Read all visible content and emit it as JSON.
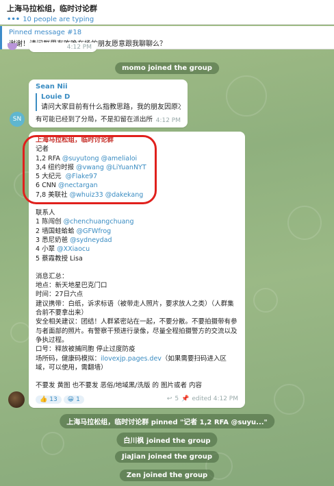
{
  "header": {
    "title": "上海马拉松组，临时讨论群",
    "typing": "10 people are typing",
    "typing_dots": "•••"
  },
  "pinned": {
    "label": "Pinned message #18",
    "text": "谢谢！请问群里有昨晚在场的朋友愿意跟我聊聊么？"
  },
  "partial_time": "4:12 PM",
  "service": {
    "momo": "momo joined the group",
    "pin": "上海马拉松组，临时讨论群 pinned \"记者 1,2 RFA @suyu...\"",
    "baichuan": "白川枫 joined the group",
    "jiajian": "JiaJian joined the group",
    "zen": "Zen joined the group"
  },
  "sean_message": {
    "avatar": "SN",
    "avatar_color": "#5fb6cf",
    "sender": "Sean Nii",
    "reply_name": "Louie D",
    "reply_text": "请问大家目前有什么指教思路，我的朋友因原次...",
    "text": "有可能已经到了分局，不是扣留在派出所",
    "time": "4:12 PM"
  },
  "main_message": {
    "sender": "上海马拉松组，临时讨论群",
    "reporters_header": "记者",
    "reporters": [
      {
        "prefix": "1,2 RFA ",
        "handles": "@suyutong @amelialoi"
      },
      {
        "prefix": "3,4 纽约时报 ",
        "handles": "@vwang @LiYuanNYT"
      },
      {
        "prefix": "5 大纪元  ",
        "handles": "@Flake97"
      },
      {
        "prefix": "6 CNN ",
        "handles": "@nectargan"
      },
      {
        "prefix": "7,8 美联社 ",
        "handles": "@whuiz33 @dakekang"
      }
    ],
    "contacts_header": "联系人",
    "contacts": [
      {
        "prefix": "1 陈闯创 ",
        "handle": "@chenchuangchuang"
      },
      {
        "prefix": "2 墙国蛙蛤蛤 ",
        "handle": "@GFWfrog"
      },
      {
        "prefix": "3 悉尼奶爸 ",
        "handle": "@sydneydad"
      },
      {
        "prefix": "4 小翠 ",
        "handle": "@XXiaocu"
      },
      {
        "prefix": "5 蔡霞教授 Lisa",
        "handle": ""
      }
    ],
    "summary_header": "消息汇总：",
    "location": "地点：新天地星巴克门口",
    "time_line": "时间：27日六点",
    "advice": "建议携带：白纸，诉求标语（被带走人照片，要求放人之类）（人群集合前不要拿出来）",
    "safety": "安全相关建议：团结！人群紧密站在一起，不要分散。不要拍摄带有参与者面部的照片。有警察干预进行录像，尽量全程拍摄警方的交流以及争执过程。",
    "slogan": "口号：释放被捕同胞 停止过度防疫",
    "site_prefix": "场所码，健康码模拟：",
    "site_link": "ilovexjp.pages.dev",
    "site_suffix": "（如果需要扫码进入区域，可以使用，需翻墙）",
    "dont": "不要发 黄图 也不要发 恶俗/地域黑/洗版 的 图片或者 内容",
    "reaction1_emoji": "👍",
    "reaction1_count": "13",
    "reaction2_emoji": "😀",
    "reaction2_count": "1",
    "replies": "5",
    "edited": "edited 4:12 PM"
  }
}
